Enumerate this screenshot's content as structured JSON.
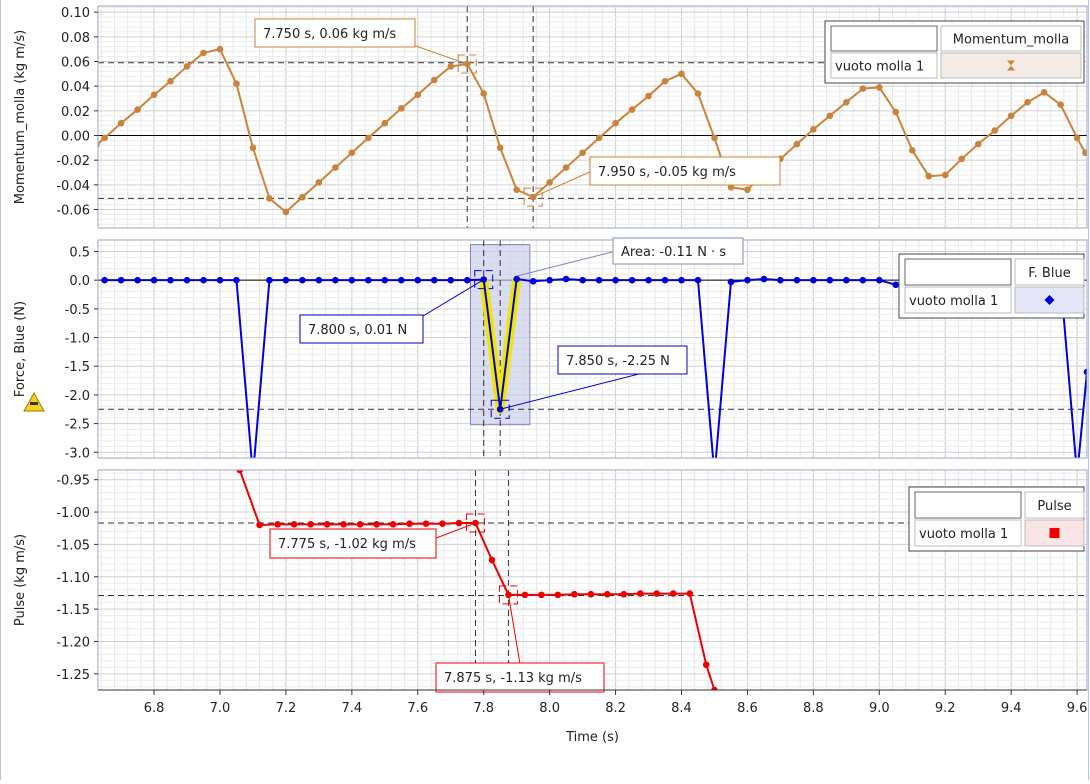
{
  "x_axis": {
    "label": "Time (s)",
    "range": [
      6.63,
      9.63
    ],
    "tick_labels": [
      "6.8",
      "7.0",
      "7.2",
      "7.4",
      "7.6",
      "7.8",
      "8.0",
      "8.2",
      "8.4",
      "8.6",
      "8.8",
      "9.0",
      "9.2",
      "9.4",
      "9.6"
    ]
  },
  "chart_data": [
    {
      "type": "line",
      "ylabel": "Momentum_molla (kg m/s)",
      "ylim": [
        -0.075,
        0.105
      ],
      "y_tick_labels": [
        "-0.06",
        "-0.04",
        "-0.02",
        "0.00",
        "0.02",
        "0.04",
        "0.06",
        "0.08",
        "0.10"
      ],
      "series": [
        {
          "name": "Momentum_molla",
          "run": "vuoto molla 1",
          "color": "#c8843c",
          "x": [
            6.625,
            6.65,
            6.7,
            6.75,
            6.8,
            6.85,
            6.9,
            6.95,
            7.0,
            7.05,
            7.1,
            7.15,
            7.2,
            7.25,
            7.3,
            7.35,
            7.4,
            7.45,
            7.5,
            7.55,
            7.6,
            7.65,
            7.7,
            7.75,
            7.8,
            7.85,
            7.9,
            7.95,
            8.0,
            8.05,
            8.1,
            8.15,
            8.2,
            8.25,
            8.3,
            8.35,
            8.4,
            8.45,
            8.5,
            8.55,
            8.6,
            8.65,
            8.7,
            8.75,
            8.8,
            8.85,
            8.9,
            8.95,
            9.0,
            9.05,
            9.1,
            9.15,
            9.2,
            9.25,
            9.3,
            9.35,
            9.4,
            9.45,
            9.5,
            9.55,
            9.6,
            9.625
          ],
          "y": [
            -0.008,
            -0.002,
            0.01,
            0.021,
            0.033,
            0.044,
            0.056,
            0.067,
            0.07,
            0.042,
            -0.01,
            -0.051,
            -0.062,
            -0.05,
            -0.038,
            -0.026,
            -0.014,
            -0.002,
            0.01,
            0.022,
            0.033,
            0.045,
            0.056,
            0.058,
            0.034,
            -0.01,
            -0.044,
            -0.05,
            -0.038,
            -0.026,
            -0.014,
            -0.002,
            0.01,
            0.021,
            0.032,
            0.044,
            0.05,
            0.034,
            -0.002,
            -0.042,
            -0.044,
            -0.031,
            -0.019,
            -0.007,
            0.005,
            0.016,
            0.027,
            0.038,
            0.039,
            0.019,
            -0.012,
            -0.033,
            -0.032,
            -0.019,
            -0.007,
            0.004,
            0.016,
            0.027,
            0.035,
            0.025,
            -0.002,
            -0.014
          ]
        }
      ],
      "hline_at_zero": true,
      "cursor_lines": {
        "x": [
          7.75,
          7.95
        ],
        "y": [
          0.059,
          -0.051
        ]
      },
      "annotations": [
        {
          "text": "7.750 s, 0.06 kg m/s",
          "x": 7.75,
          "y": 0.058
        },
        {
          "text": "7.950 s, -0.05 kg m/s",
          "x": 7.95,
          "y": -0.05
        }
      ],
      "legend": {
        "name": "Momentum_molla",
        "run": "vuoto molla 1",
        "symbol": "hourglass-icon",
        "position": "top-right"
      }
    },
    {
      "type": "line",
      "ylabel": "Force, Blue (N)",
      "ylim": [
        -3.1,
        0.7
      ],
      "y_tick_labels": [
        "-3.0",
        "-2.5",
        "-2.0",
        "-1.5",
        "-1.0",
        "-0.5",
        "0.0",
        "0.5"
      ],
      "series": [
        {
          "name": "F. Blue",
          "run": "vuoto molla 1",
          "color": "#0000dd",
          "x": [
            6.65,
            6.7,
            6.75,
            6.8,
            6.85,
            6.9,
            6.95,
            7.0,
            7.05,
            7.1,
            7.15,
            7.2,
            7.25,
            7.3,
            7.35,
            7.4,
            7.45,
            7.5,
            7.55,
            7.6,
            7.65,
            7.7,
            7.75,
            7.8,
            7.85,
            7.9,
            7.95,
            8.0,
            8.05,
            8.1,
            8.15,
            8.2,
            8.25,
            8.3,
            8.35,
            8.4,
            8.45,
            8.5,
            8.55,
            8.6,
            8.65,
            8.7,
            8.75,
            8.8,
            8.85,
            8.9,
            8.95,
            9.0,
            9.05,
            9.1,
            9.15,
            9.2,
            9.25,
            9.3,
            9.35,
            9.4,
            9.45,
            9.5,
            9.55,
            9.6,
            9.63
          ],
          "y": [
            0.0,
            0.0,
            0.0,
            0.0,
            0.0,
            0.0,
            0.0,
            0.0,
            0.0,
            -3.4,
            0.0,
            0.0,
            0.0,
            0.0,
            0.0,
            0.0,
            0.0,
            0.0,
            0.0,
            0.0,
            0.0,
            0.0,
            0.0,
            0.01,
            -2.25,
            0.02,
            -0.02,
            0.0,
            0.02,
            0.0,
            0.0,
            0.0,
            0.0,
            0.0,
            0.0,
            0.0,
            0.0,
            -3.4,
            -0.03,
            0.0,
            0.02,
            0.0,
            0.0,
            0.0,
            0.0,
            0.0,
            0.0,
            0.0,
            -0.08,
            0.0,
            0.0,
            0.0,
            0.0,
            0.0,
            0.0,
            0.0,
            0.0,
            0.0,
            0.0,
            -3.4,
            -1.6
          ]
        }
      ],
      "hline_at_zero": true,
      "cursor_lines": {
        "x": [
          7.8,
          7.85
        ],
        "y": [
          -2.25
        ]
      },
      "area_selection": {
        "x": [
          7.76,
          7.94
        ],
        "highlight": [
          7.8,
          7.85,
          7.9
        ],
        "text": "Area: -0.11 N · s"
      },
      "annotations": [
        {
          "text": "7.800 s, 0.01 N",
          "x": 7.8,
          "y": 0.01
        },
        {
          "text": "7.850 s, -2.25 N",
          "x": 7.85,
          "y": -2.25
        }
      ],
      "legend": {
        "name": "F. Blue",
        "run": "vuoto molla 1",
        "symbol": "diamond-icon",
        "position": "top-right"
      }
    },
    {
      "type": "line",
      "ylabel": "Pulse (kg m/s)",
      "ylim": [
        -1.275,
        -0.935
      ],
      "y_tick_labels": [
        "-1.25",
        "-1.20",
        "-1.15",
        "-1.10",
        "-1.05",
        "-1.00",
        "-0.95"
      ],
      "series": [
        {
          "name": "Pulse",
          "run": "vuoto molla 1",
          "color": "#ee0000",
          "x": [
            7.06,
            7.12,
            7.175,
            7.225,
            7.275,
            7.325,
            7.375,
            7.425,
            7.475,
            7.525,
            7.575,
            7.625,
            7.675,
            7.725,
            7.775,
            7.825,
            7.875,
            7.925,
            7.975,
            8.025,
            8.075,
            8.125,
            8.175,
            8.225,
            8.275,
            8.325,
            8.375,
            8.425,
            8.475,
            8.5
          ],
          "y": [
            -0.935,
            -1.02,
            -1.019,
            -1.019,
            -1.019,
            -1.019,
            -1.019,
            -1.019,
            -1.019,
            -1.019,
            -1.018,
            -1.018,
            -1.018,
            -1.017,
            -1.017,
            -1.074,
            -1.128,
            -1.128,
            -1.128,
            -1.128,
            -1.127,
            -1.127,
            -1.127,
            -1.127,
            -1.126,
            -1.126,
            -1.126,
            -1.126,
            -1.236,
            -1.275
          ]
        }
      ],
      "cursor_lines": {
        "x": [
          7.775,
          7.875
        ],
        "y": [
          -1.017,
          -1.129
        ]
      },
      "annotations": [
        {
          "text": "7.775 s, -1.02 kg m/s",
          "x": 7.775,
          "y": -1.017
        },
        {
          "text": "7.875 s, -1.13 kg m/s",
          "x": 7.875,
          "y": -1.128
        }
      ],
      "legend": {
        "name": "Pulse",
        "run": "vuoto molla 1",
        "symbol": "square-icon",
        "position": "top-right"
      }
    }
  ]
}
